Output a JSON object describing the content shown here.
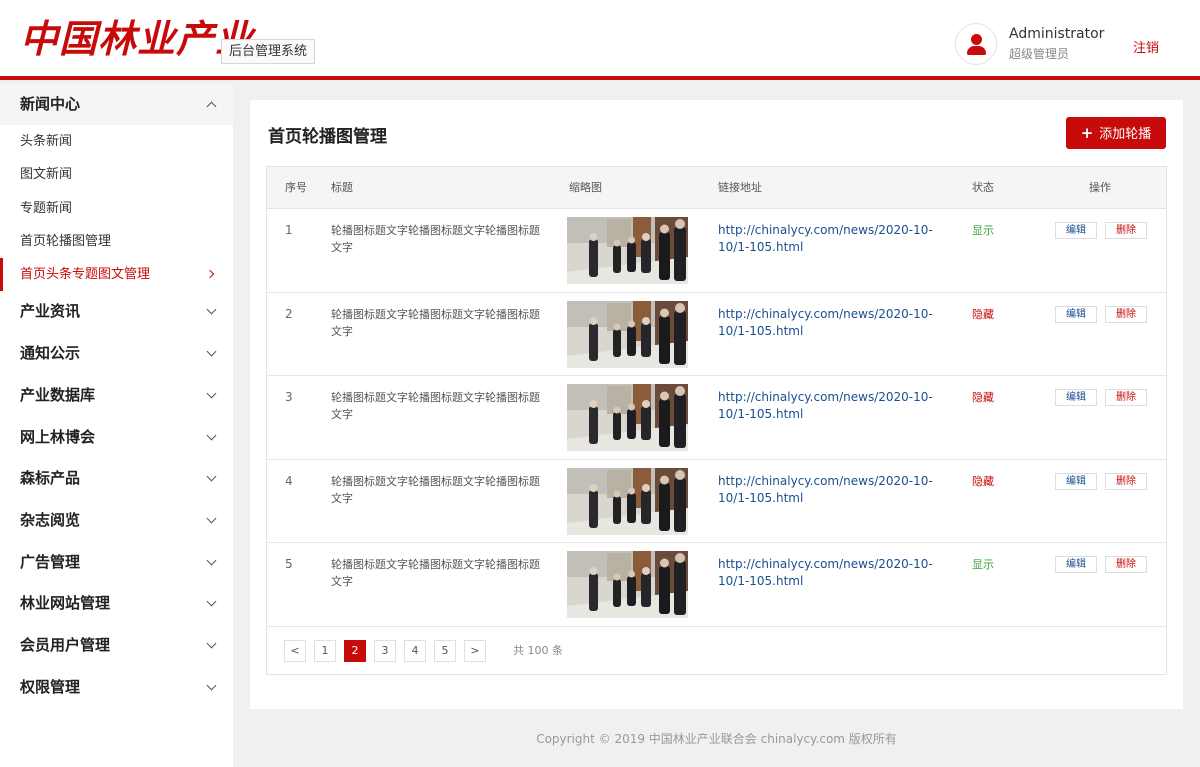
{
  "header": {
    "logo": "中国林业产业",
    "system_name": "后台管理系统",
    "user_name": "Administrator",
    "user_role": "超级管理员",
    "logout_label": "注销"
  },
  "sidebar": {
    "open_group": {
      "label": "新闻中心",
      "items": [
        "头条新闻",
        "图文新闻",
        "专题新闻",
        "首页轮播图管理",
        "首页头条专题图文管理"
      ],
      "active_index": 4
    },
    "groups": [
      "产业资讯",
      "通知公示",
      "产业数据库",
      "网上林博会",
      "森标产品",
      "杂志阅览",
      "广告管理",
      "林业网站管理",
      "会员用户管理",
      "权限管理"
    ]
  },
  "main": {
    "title": "首页轮播图管理",
    "add_button": "添加轮播",
    "columns": [
      "序号",
      "标题",
      "缩略图",
      "链接地址",
      "状态",
      "操作"
    ],
    "rows": [
      {
        "idx": "1",
        "title": "轮播图标题文字轮播图标题文字轮播图标题文字",
        "link": "http://chinalycy.com/news/2020-10-10/1-105.html",
        "status": "显示",
        "status_type": "show"
      },
      {
        "idx": "2",
        "title": "轮播图标题文字轮播图标题文字轮播图标题文字",
        "link": "http://chinalycy.com/news/2020-10-10/1-105.html",
        "status": "隐藏",
        "status_type": "hide"
      },
      {
        "idx": "3",
        "title": "轮播图标题文字轮播图标题文字轮播图标题文字",
        "link": "http://chinalycy.com/news/2020-10-10/1-105.html",
        "status": "隐藏",
        "status_type": "hide"
      },
      {
        "idx": "4",
        "title": "轮播图标题文字轮播图标题文字轮播图标题文字",
        "link": "http://chinalycy.com/news/2020-10-10/1-105.html",
        "status": "隐藏",
        "status_type": "hide"
      },
      {
        "idx": "5",
        "title": "轮播图标题文字轮播图标题文字轮播图标题文字",
        "link": "http://chinalycy.com/news/2020-10-10/1-105.html",
        "status": "显示",
        "status_type": "show"
      }
    ],
    "edit_label": "编辑",
    "delete_label": "删除",
    "pagination": {
      "prev": "<",
      "next": ">",
      "pages": [
        "1",
        "2",
        "3",
        "4",
        "5"
      ],
      "current": "2",
      "total": "共 100 条"
    }
  },
  "footer": {
    "copyright": "Copyright © 2019 中国林业产业联合会 chinalycy.com 版权所有"
  },
  "colors": {
    "brand": "#c70a0a",
    "link": "#1a4f8f",
    "status_show": "#3aa23a",
    "status_hide": "#c70a0a"
  }
}
